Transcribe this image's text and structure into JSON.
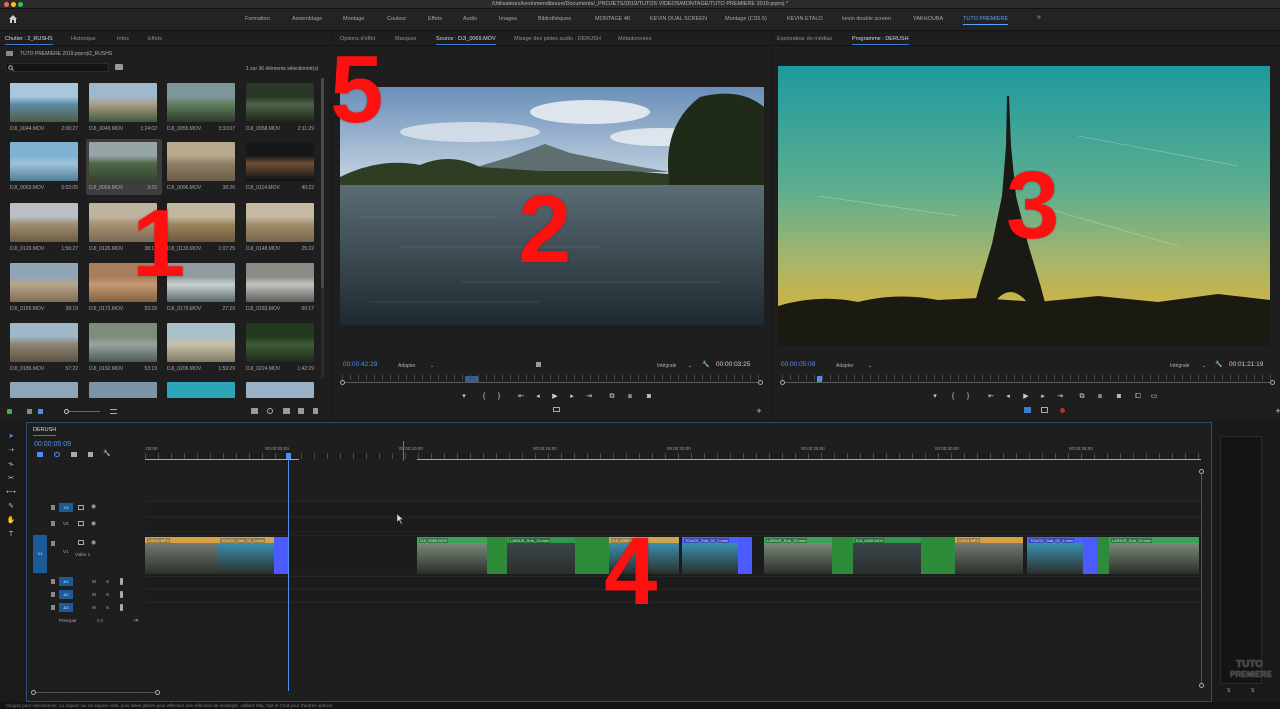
{
  "titlebar": {
    "title": "/Utilisateurs/kevinmendiboure/Documents/_PROJETS/2019/TUTOS VIDEOS/MONTAGE/TUTO PREMIERE 2019.prproj *"
  },
  "workspaces": [
    "Formation",
    "Assemblage",
    "Montage",
    "Couleur",
    "Effets",
    "Audio",
    "Images",
    "Bibliothèques",
    "MONTAGE 4K",
    "KEVIN DUAL SCREEN",
    "Montage (CS5.5)",
    "KEVIN ETALO",
    "kevin double screen",
    "YAKHOUBA",
    "TUTO PREMIERE"
  ],
  "workspace_active": "TUTO PREMIERE",
  "workspace_more": "»",
  "project": {
    "tabs": [
      "Chutier : 2_RUSHS",
      "Historique",
      "Infos",
      "Effets"
    ],
    "path": "TUTO PREMIERE 2019.prproj\\2_RUSHS",
    "selection": "1 sur 36 éléments sélectionné(s)",
    "clips": [
      {
        "name": "DJI_0044.MOV",
        "dur": "2:00:27"
      },
      {
        "name": "DJI_0049.MOV",
        "dur": "1:24:02"
      },
      {
        "name": "DJI_0055.MOV",
        "dur": "3:33:07"
      },
      {
        "name": "DJI_0058.MOV",
        "dur": "2:11:29"
      },
      {
        "name": "DJI_0063.MOV",
        "dur": "5:02:05"
      },
      {
        "name": "DJI_0069.MOV",
        "dur": "3:25"
      },
      {
        "name": "DJI_0096.MOV",
        "dur": "38:26"
      },
      {
        "name": "DJI_0114.MOV",
        "dur": "40:22"
      },
      {
        "name": "DJI_0120.MOV",
        "dur": "1:56:27"
      },
      {
        "name": "DJI_0126.MOV",
        "dur": "38:19"
      },
      {
        "name": "DJI_0133.MOV",
        "dur": "1:07:25"
      },
      {
        "name": "DJI_0148.MOV",
        "dur": "25:22"
      },
      {
        "name": "DJI_0155.MOV",
        "dur": "38:19"
      },
      {
        "name": "DJI_0172.MOV",
        "dur": "53:29"
      },
      {
        "name": "DJI_0179.MOV",
        "dur": "27:29"
      },
      {
        "name": "DJI_0183.MOV",
        "dur": "50:17"
      },
      {
        "name": "DJI_0186.MOV",
        "dur": "57:22"
      },
      {
        "name": "DJI_0192.MOV",
        "dur": "53:19"
      },
      {
        "name": "DJI_0206.MOV",
        "dur": "1:59:29"
      },
      {
        "name": "DJI_0224.MOV",
        "dur": "1:42:29"
      }
    ]
  },
  "source": {
    "tabs": [
      "Options d'effet",
      "Marques",
      "Source : DJI_0069.MOV",
      "Mixage des pistes audio : DERUSH",
      "Métadonnées"
    ],
    "timecode": "00:00:42:29",
    "fit": "Adapter",
    "quality": "Intégrale",
    "duration": "00:00:03:25"
  },
  "program": {
    "tabs": [
      "Explorateur de médias",
      "Programme : DERUSH"
    ],
    "timecode": "00:00:05:09",
    "fit": "Adapter",
    "quality": "Intégrale",
    "duration": "00:01:21:19"
  },
  "timeline": {
    "tab": "DERUSH",
    "timecode": "00:00:05:09",
    "ruler": [
      ":00:00",
      "00:00:05:00",
      "00:00:10:00",
      "00:00:15:00",
      "00:00:20:00",
      "00:00:25:00",
      "00:00:30:00",
      "00:00:35:00"
    ],
    "tracks": {
      "v3": "V3",
      "v2": "V2",
      "v1": "V1",
      "v1_name": "Vidéo 1",
      "a1": "A1",
      "a2": "A2",
      "a3": "A3",
      "master": "Principal",
      "master_val": "0,0",
      "m": "M",
      "s": "S"
    },
    "clips": [
      "C0011.MP4",
      "TOUCK_Sub_01_1.mov",
      "DJI_0069.MOV",
      "LARIUS_Sub_13.mov",
      "DJI_0069.MOV",
      "TOUCK_Sub_01_1.mov",
      "LARIUS_Sub_13.mov",
      "DJI_0069.MOV",
      "C0011.MP4",
      "TOUCK_Sub_01_1.mov",
      "LARIUS_Sub_13.mov"
    ]
  },
  "meter": {
    "labels": [
      "S",
      "S"
    ]
  },
  "statusbar": {
    "text": "Cliquez pour sélectionner, ou cliquez sur un espace vide, puis faites glisser pour effectuer une sélection de rectangle. Utilisez Maj, Opt et Cmd pour d'autres options."
  },
  "overlays": {
    "n1": "1",
    "n2": "2",
    "n3": "3",
    "n4": "4",
    "n5": "5",
    "watermark_top": "TUTO",
    "watermark_bottom": "PREMIERE"
  },
  "icons": [
    "home-icon",
    "search-icon",
    "new-bin-icon",
    "list-view-icon",
    "icon-view-icon",
    "zoom-slider",
    "play-icon",
    "step-back-icon",
    "step-forward-icon",
    "go-to-in-icon",
    "go-to-out-icon",
    "mark-in-icon",
    "mark-out-icon",
    "insert-icon",
    "overwrite-icon",
    "export-frame-icon",
    "wrench-icon",
    "add-button-icon",
    "selection-tool-icon",
    "razor-tool-icon",
    "hand-tool-icon",
    "pen-tool-icon",
    "type-tool-icon",
    "eye-icon",
    "lock-icon",
    "mic-icon"
  ]
}
